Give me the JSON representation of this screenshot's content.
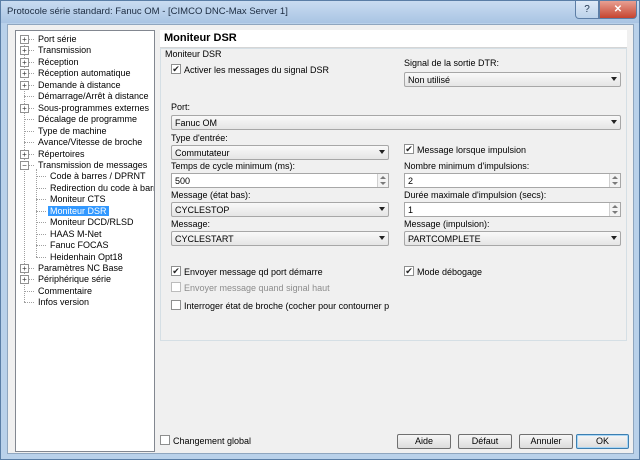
{
  "window": {
    "title": "Protocole série standard: Fanuc OM - [CIMCO DNC-Max Server 1]",
    "help_label": "?",
    "close_label": "✕"
  },
  "tree": {
    "items": [
      {
        "label": "Port série",
        "level": 0,
        "expander": "+"
      },
      {
        "label": "Transmission",
        "level": 0,
        "expander": "+"
      },
      {
        "label": "Réception",
        "level": 0,
        "expander": "+"
      },
      {
        "label": "Réception automatique",
        "level": 0,
        "expander": "+"
      },
      {
        "label": "Demande à distance",
        "level": 0,
        "expander": "+"
      },
      {
        "label": "Démarrage/Arrêt à distance",
        "level": 0,
        "expander": ""
      },
      {
        "label": "Sous-programmes externes",
        "level": 0,
        "expander": "+"
      },
      {
        "label": "Décalage de programme",
        "level": 0,
        "expander": ""
      },
      {
        "label": "Type de machine",
        "level": 0,
        "expander": ""
      },
      {
        "label": "Avance/Vitesse de broche",
        "level": 0,
        "expander": ""
      },
      {
        "label": "Répertoires",
        "level": 0,
        "expander": "+"
      },
      {
        "label": "Transmission de messages",
        "level": 0,
        "expander": "−"
      },
      {
        "label": "Code à barres / DPRNT",
        "level": 1,
        "expander": ""
      },
      {
        "label": "Redirection du code à barres",
        "level": 1,
        "expander": ""
      },
      {
        "label": "Moniteur CTS",
        "level": 1,
        "expander": ""
      },
      {
        "label": "Moniteur DSR",
        "level": 1,
        "expander": "",
        "selected": true
      },
      {
        "label": "Moniteur DCD/RLSD",
        "level": 1,
        "expander": ""
      },
      {
        "label": "HAAS M-Net",
        "level": 1,
        "expander": ""
      },
      {
        "label": "Fanuc FOCAS",
        "level": 1,
        "expander": ""
      },
      {
        "label": "Heidenhain Opt18",
        "level": 1,
        "expander": ""
      },
      {
        "label": "Paramètres NC Base",
        "level": 0,
        "expander": "+"
      },
      {
        "label": "Périphérique série",
        "level": 0,
        "expander": "+"
      },
      {
        "label": "Commentaire",
        "level": 0,
        "expander": ""
      },
      {
        "label": "Infos version",
        "level": 0,
        "expander": ""
      }
    ]
  },
  "panel": {
    "title": "Moniteur DSR",
    "group_label": "Moniteur DSR",
    "activate_messages": {
      "label": "Activer les messages du signal DSR",
      "checked": true
    },
    "signal_output": {
      "label": "Signal de la sortie DTR:",
      "value": "Non utilisé"
    },
    "port": {
      "label": "Port:",
      "value": "Fanuc OM"
    },
    "input_type": {
      "label": "Type d'entrée:",
      "value": "Commutateur"
    },
    "message_on_pulse": {
      "label": "Message lorsque impulsion",
      "checked": true
    },
    "min_cycle_time": {
      "label": "Temps de cycle minimum (ms):",
      "value": "500"
    },
    "min_pulses": {
      "label": "Nombre minimum d'impulsions:",
      "value": "2"
    },
    "message_low": {
      "label": "Message (état bas):",
      "value": "CYCLESTOP"
    },
    "max_pulse_duration": {
      "label": "Durée maximale d'impulsion (secs):",
      "value": "1"
    },
    "message": {
      "label": "Message:",
      "value": "CYCLESTART"
    },
    "message_pulse": {
      "label": "Message (impulsion):",
      "value": "PARTCOMPLETE"
    },
    "send_on_port_start": {
      "label": "Envoyer message qd port démarre",
      "checked": true
    },
    "debug_mode": {
      "label": "Mode débogage",
      "checked": true
    },
    "send_when_high": {
      "label": "Envoyer message quand signal haut",
      "checked": false,
      "disabled": true
    },
    "query_spindle": {
      "label": "Interroger état de broche (cocher pour contourner prob. de p",
      "checked": false
    }
  },
  "footer": {
    "global_change": {
      "label": "Changement global",
      "checked": false
    },
    "help_button": "Aide",
    "default_button": "Défaut",
    "cancel_button": "Annuler",
    "ok_button": "OK"
  }
}
